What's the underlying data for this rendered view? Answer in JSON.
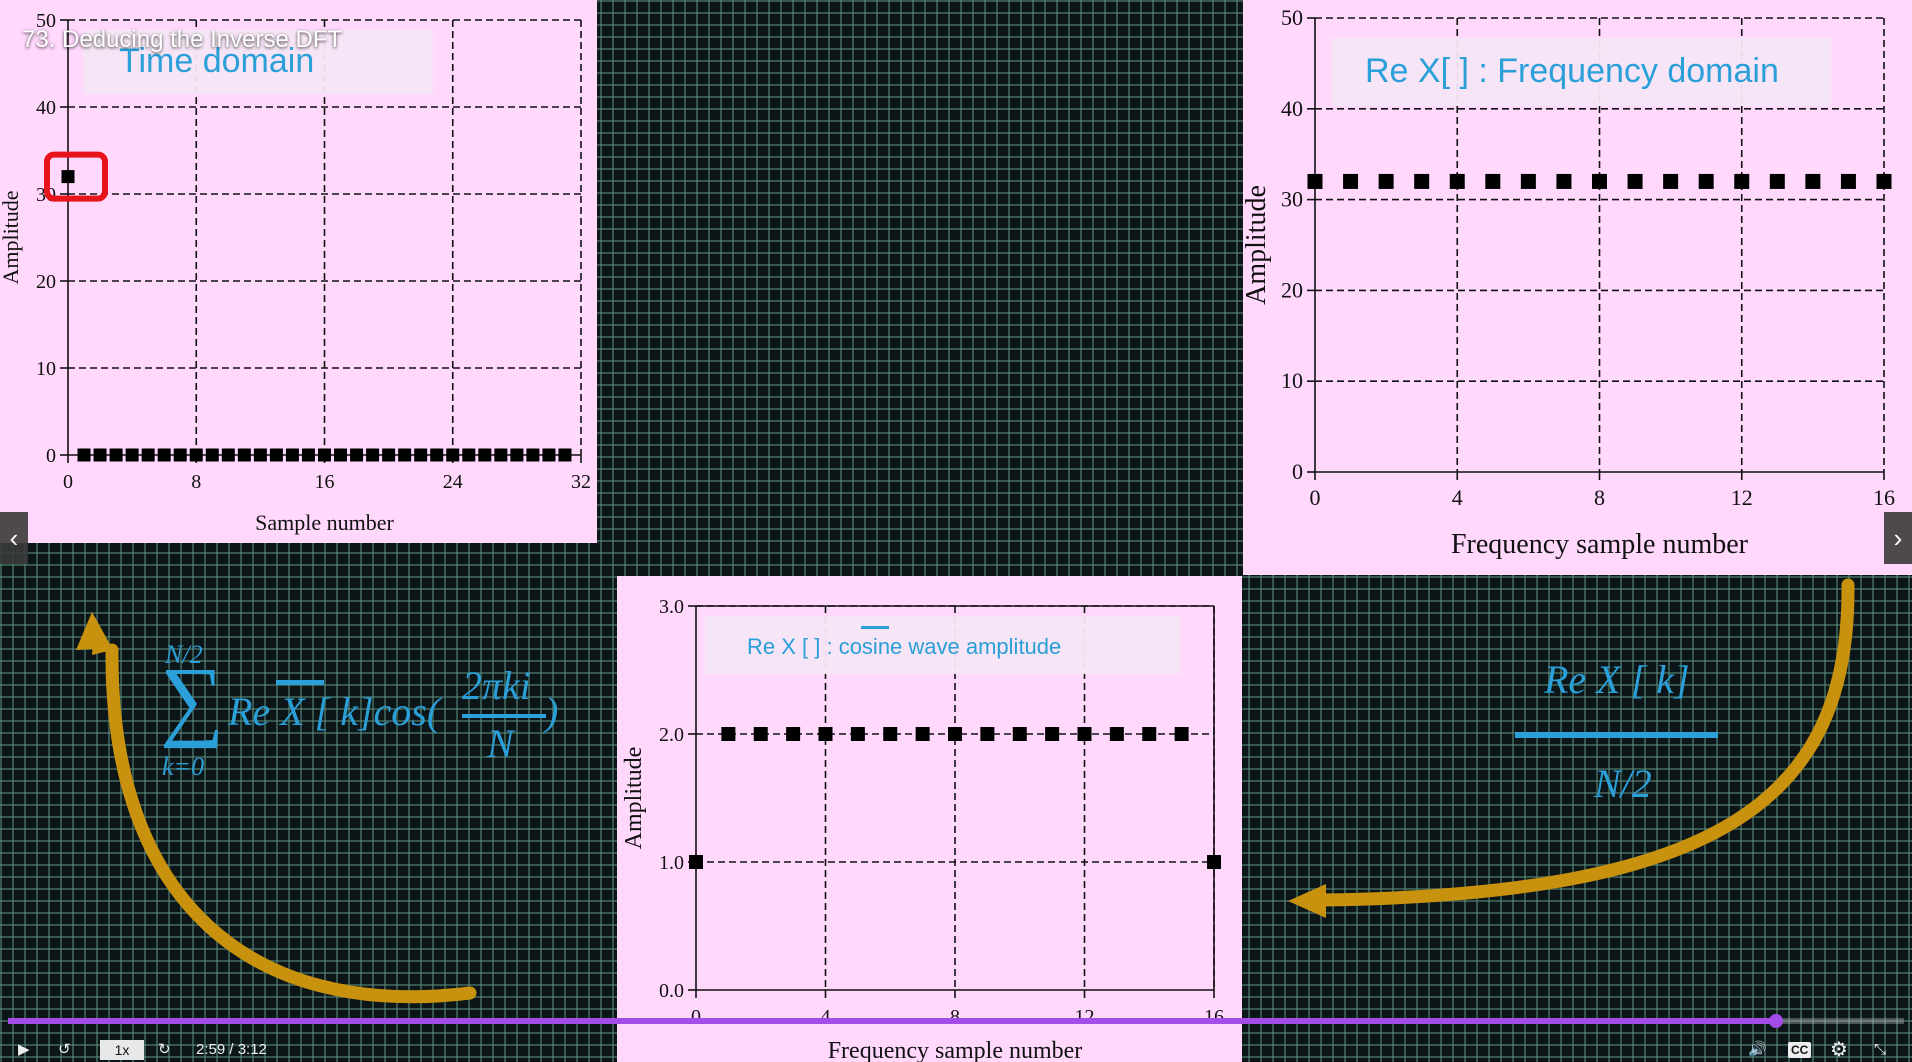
{
  "video": {
    "title": "73. Deducing the Inverse DFT",
    "nav_prev": "‹",
    "nav_next": "›"
  },
  "equations": {
    "sum_upper": "N/2",
    "sum_symbol": "∑",
    "sum_lower": "k=0",
    "sum_body": "Re X [ k]cos(",
    "frac_numerator": "2πki",
    "frac_denominator": "N",
    "frac_close": ")",
    "div_numerator": "Re X [ k]",
    "div_denominator": "N/2"
  },
  "player": {
    "play_icon": "▶",
    "rewind_icon": "↺",
    "speed": "1x",
    "forward_icon": "↻",
    "time": "2:59 / 3:12",
    "progress": 0.9323,
    "volume_icon": "🔊",
    "cc_label": "CC",
    "settings_icon": "⚙",
    "fullscreen_icon": "⤡",
    "accent_color": "#a34de8"
  },
  "chart_data": [
    {
      "id": "time",
      "type": "scatter",
      "title": "Time domain",
      "xlabel": "Sample number",
      "ylabel": "Amplitude",
      "xlim": [
        0,
        32
      ],
      "ylim": [
        0,
        50
      ],
      "xticks": [
        0,
        8,
        16,
        24,
        32
      ],
      "yticks": [
        0,
        10,
        20,
        30,
        40,
        50
      ],
      "grid": true,
      "x": [
        0,
        1,
        2,
        3,
        4,
        5,
        6,
        7,
        8,
        9,
        10,
        11,
        12,
        13,
        14,
        15,
        16,
        17,
        18,
        19,
        20,
        21,
        22,
        23,
        24,
        25,
        26,
        27,
        28,
        29,
        30,
        31
      ],
      "y": [
        32,
        0,
        0,
        0,
        0,
        0,
        0,
        0,
        0,
        0,
        0,
        0,
        0,
        0,
        0,
        0,
        0,
        0,
        0,
        0,
        0,
        0,
        0,
        0,
        0,
        0,
        0,
        0,
        0,
        0,
        0,
        0
      ],
      "highlight_index": 0
    },
    {
      "id": "freq",
      "type": "scatter",
      "title": "Re X[ ] : Frequency domain",
      "xlabel": "Frequency sample number",
      "ylabel": "Amplitude",
      "xlim": [
        0,
        16
      ],
      "ylim": [
        0,
        50
      ],
      "xticks": [
        0,
        4,
        8,
        12,
        16
      ],
      "yticks": [
        0,
        10,
        20,
        30,
        40,
        50
      ],
      "grid": true,
      "x": [
        0,
        1,
        2,
        3,
        4,
        5,
        6,
        7,
        8,
        9,
        10,
        11,
        12,
        13,
        14,
        15,
        16
      ],
      "y": [
        32,
        32,
        32,
        32,
        32,
        32,
        32,
        32,
        32,
        32,
        32,
        32,
        32,
        32,
        32,
        32,
        32
      ]
    },
    {
      "id": "bottom",
      "type": "scatter",
      "title": "Re X [ ] : cosine wave amplitude",
      "xlabel": "Frequency sample number",
      "ylabel": "Amplitude",
      "xlim": [
        0,
        16
      ],
      "ylim": [
        0,
        3.0
      ],
      "xticks": [
        0,
        4,
        8,
        12,
        16
      ],
      "yticks": [
        "0.0",
        "1.0",
        "2.0",
        "3.0"
      ],
      "grid": true,
      "x": [
        0,
        1,
        2,
        3,
        4,
        5,
        6,
        7,
        8,
        9,
        10,
        11,
        12,
        13,
        14,
        15,
        16
      ],
      "y": [
        1,
        2,
        2,
        2,
        2,
        2,
        2,
        2,
        2,
        2,
        2,
        2,
        2,
        2,
        2,
        2,
        1
      ]
    }
  ]
}
